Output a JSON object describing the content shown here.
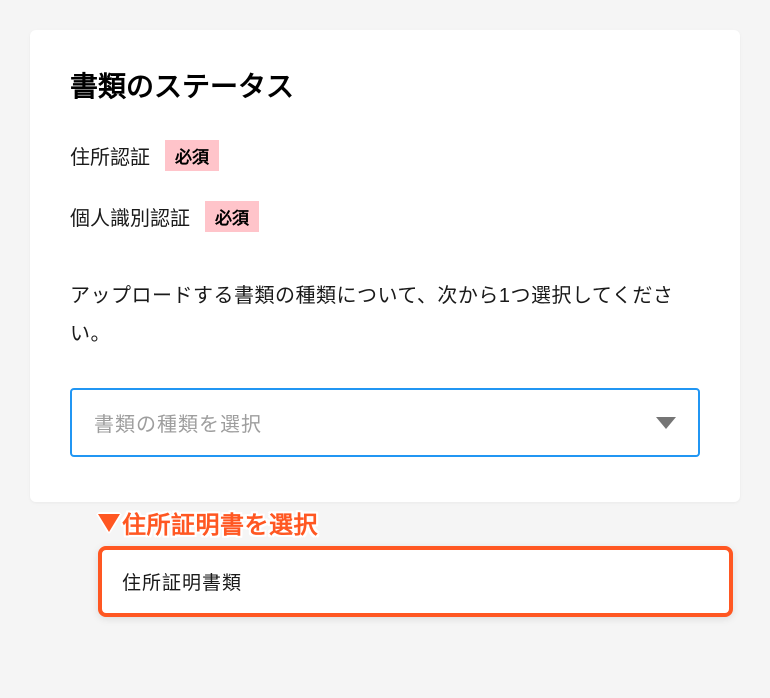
{
  "heading": "書類のステータス",
  "statuses": [
    {
      "label": "住所認証",
      "badge": "必須"
    },
    {
      "label": "個人識別認証",
      "badge": "必須"
    }
  ],
  "instruction": "アップロードする書類の種類について、次から1つ選択してください。",
  "select": {
    "placeholder": "書類の種類を選択"
  },
  "annotation": {
    "label": "住所証明書を選択",
    "highlight_color": "#ff5722"
  },
  "dropdown_option": "住所証明書類"
}
